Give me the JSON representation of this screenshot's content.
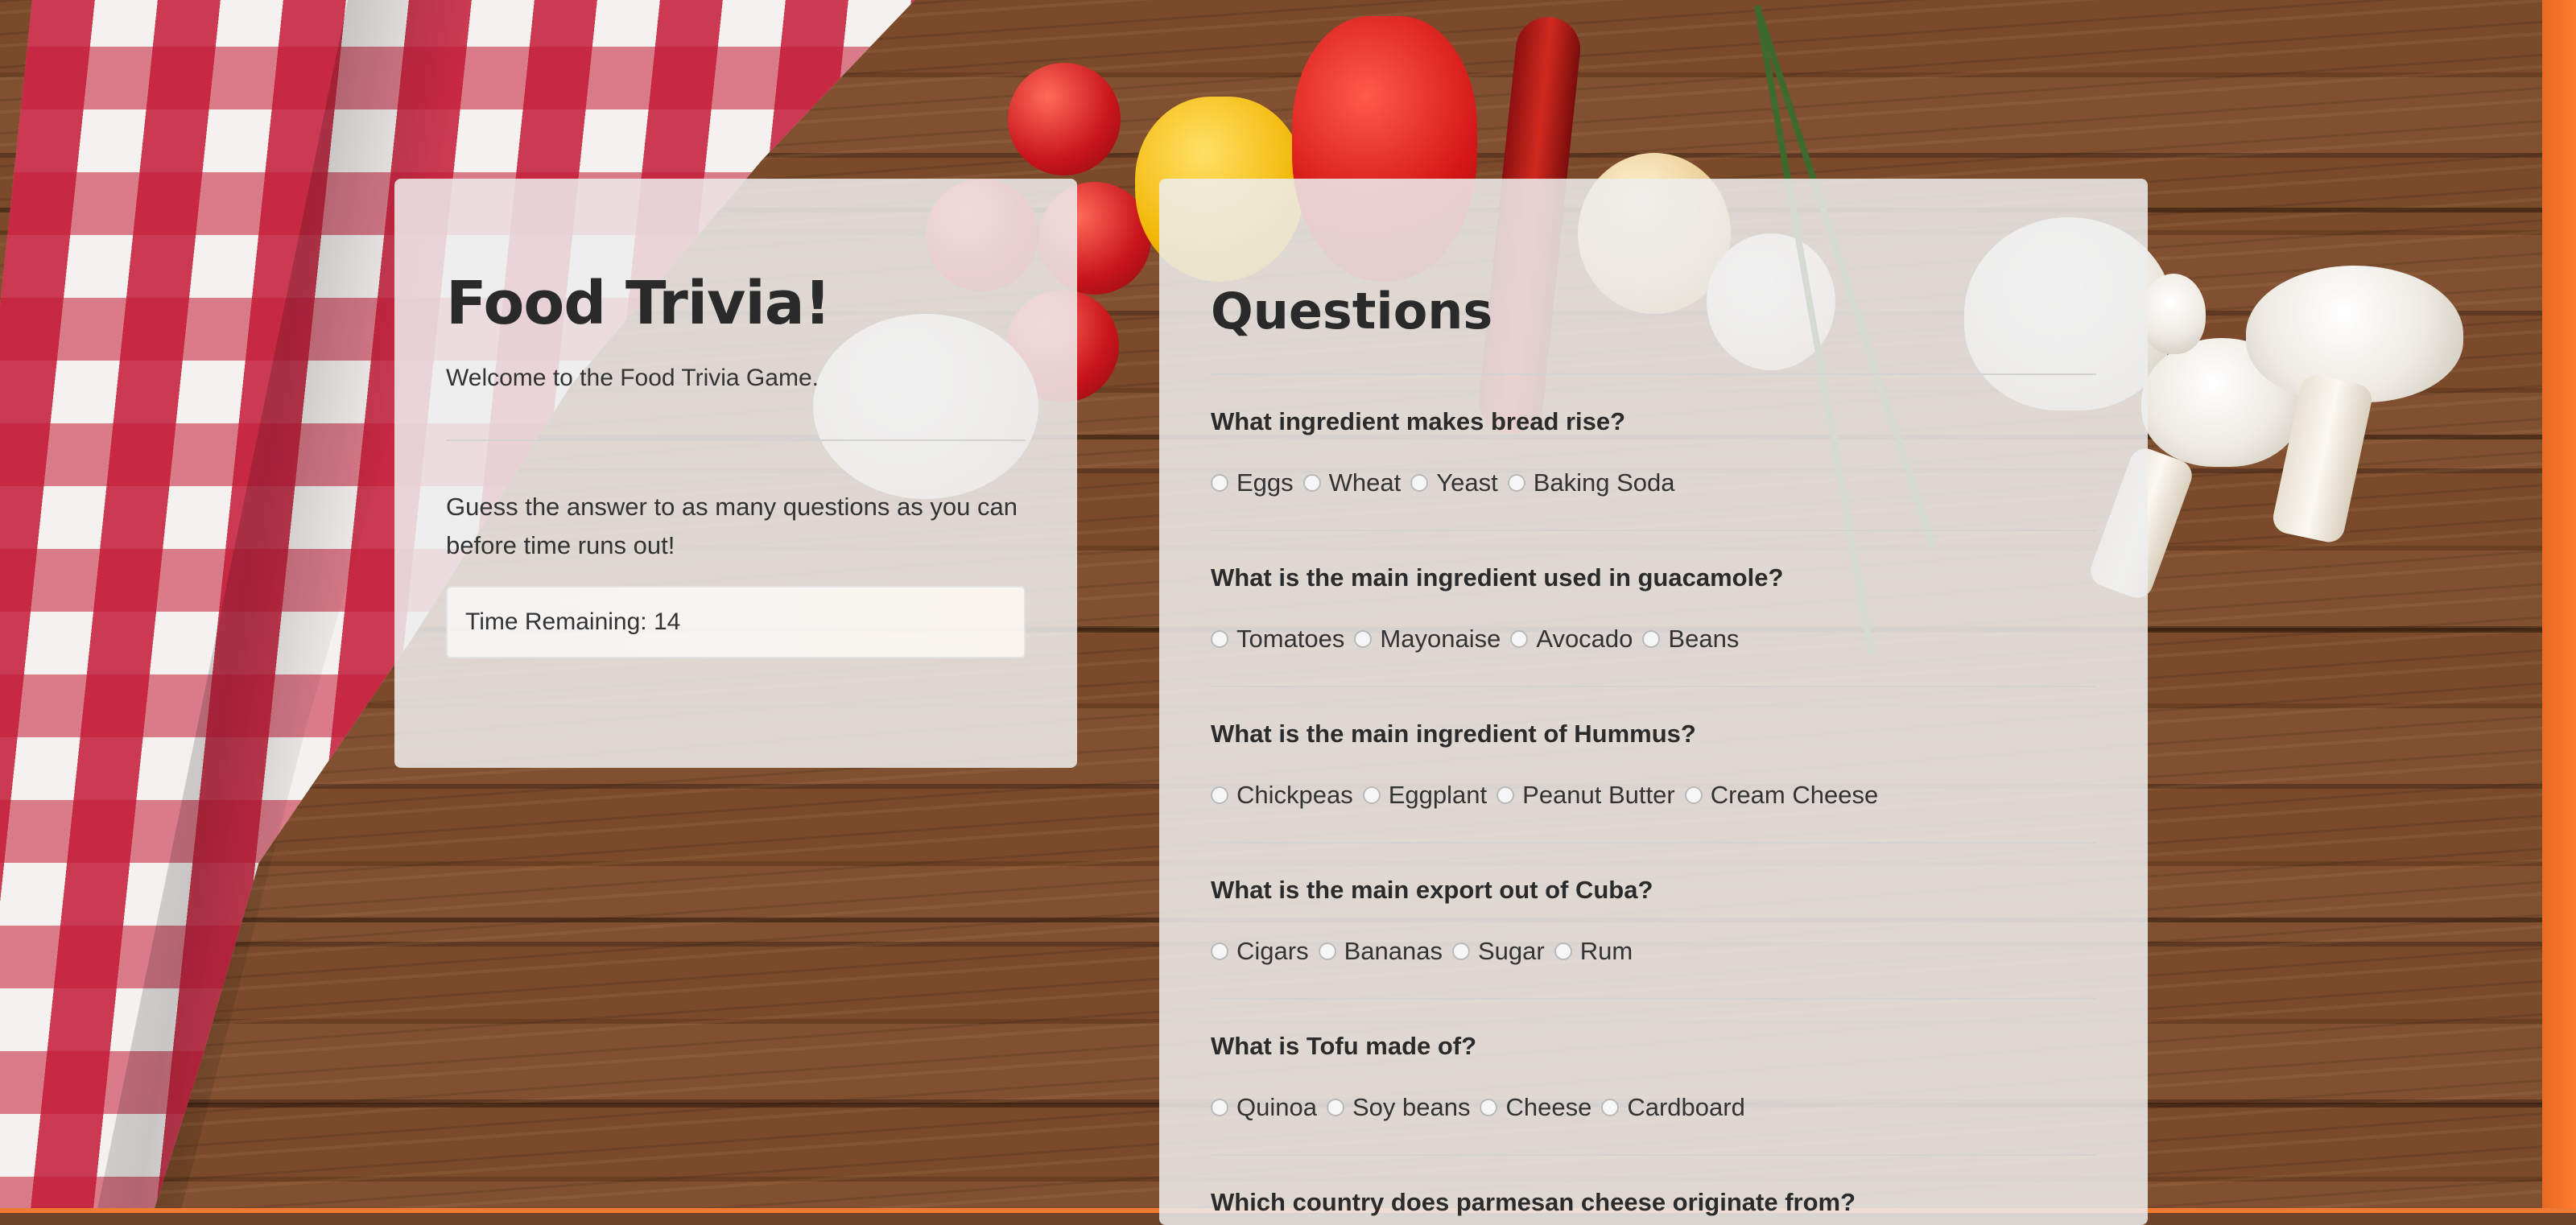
{
  "intro": {
    "title": "Food Trivia!",
    "welcome": "Welcome to the Food Trivia Game.",
    "instructions": "Guess the answer to as many questions as you can before time runs out!",
    "timer_label": "Time Remaining: 14"
  },
  "questions_panel": {
    "heading": "Questions",
    "items": [
      {
        "question": "What ingredient makes bread rise?",
        "options": [
          "Eggs",
          "Wheat",
          "Yeast",
          "Baking Soda"
        ]
      },
      {
        "question": "What is the main ingredient used in guacamole?",
        "options": [
          "Tomatoes",
          "Mayonaise",
          "Avocado",
          "Beans"
        ]
      },
      {
        "question": "What is the main ingredient of Hummus?",
        "options": [
          "Chickpeas",
          "Eggplant",
          "Peanut Butter",
          "Cream Cheese"
        ]
      },
      {
        "question": "What is the main export out of Cuba?",
        "options": [
          "Cigars",
          "Bananas",
          "Sugar",
          "Rum"
        ]
      },
      {
        "question": "What is Tofu made of?",
        "options": [
          "Quinoa",
          "Soy beans",
          "Cheese",
          "Cardboard"
        ]
      },
      {
        "question": "Which country does parmesan cheese originate from?",
        "options": []
      }
    ]
  }
}
